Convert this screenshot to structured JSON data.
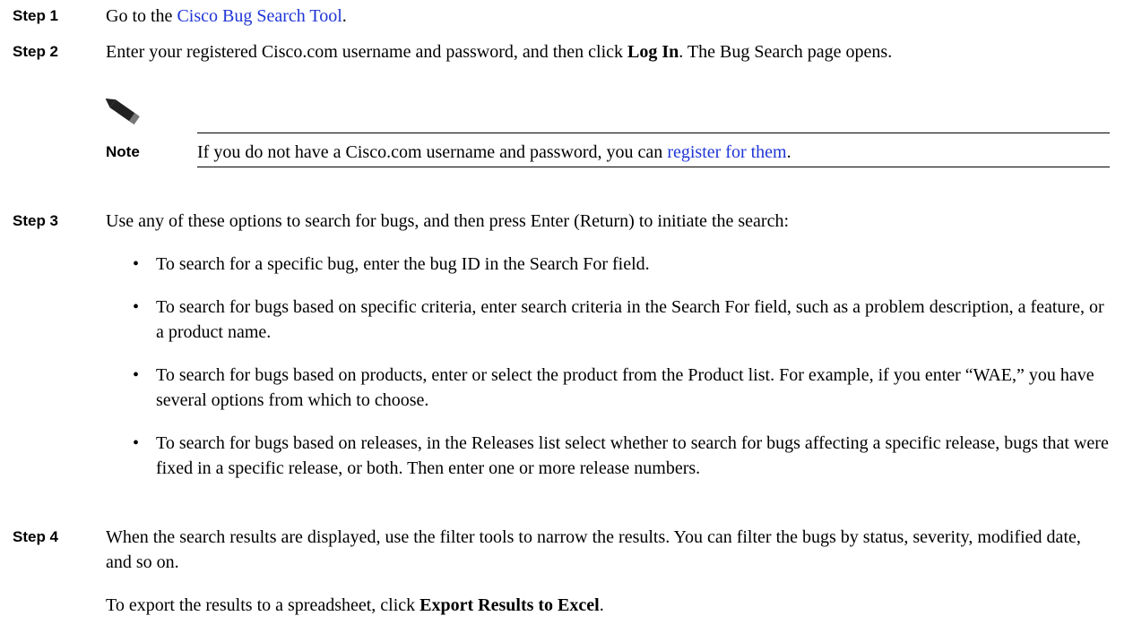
{
  "steps": {
    "s1": {
      "label": "Step 1",
      "pre": "Go to the ",
      "link": "Cisco Bug Search Tool",
      "post": "."
    },
    "s2": {
      "label": "Step 2",
      "pre": "Enter your registered Cisco.com username and password, and then click ",
      "bold": "Log In",
      "post": ". The Bug Search page opens."
    },
    "s3": {
      "label": "Step 3",
      "text": "Use any of these options to search for bugs, and then press Enter (Return) to initiate the search:"
    },
    "s4": {
      "label": "Step 4",
      "text": "When the search results are displayed, use the filter tools to narrow the results. You can filter the bugs by status, severity, modified date, and so on.",
      "export_pre": "To export the results to a spreadsheet, click ",
      "export_bold": "Export Results to Excel",
      "export_post": "."
    }
  },
  "note": {
    "label": "Note",
    "pre": "If you do not have a Cisco.com username and password, you can ",
    "link": "register for them",
    "post": "."
  },
  "bullets": [
    "To search for a specific bug, enter the bug ID in the Search For field.",
    "To search for bugs based on specific criteria, enter search criteria in the Search For field, such as a problem description, a feature, or a product name.",
    "To search for bugs based on products, enter or select the product from the Product list. For example, if you enter “WAE,” you have several options from which to choose.",
    "To search for bugs based on releases, in the Releases list select whether to search for bugs affecting a specific release, bugs that were fixed in a specific release, or both. Then enter one or more release numbers."
  ],
  "bullet_glyph": "•",
  "colors": {
    "link": "#1f35d6"
  },
  "icons": {
    "note": "pencil-icon"
  }
}
